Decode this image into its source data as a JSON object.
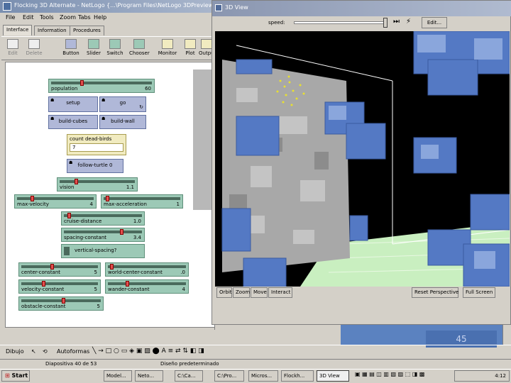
{
  "netlogo": {
    "title": "Flocking 3D Alternate - NetLogo {...\\Program Files\\NetLogo 3DPreview",
    "menus": [
      "File",
      "Edit",
      "Tools",
      "Zoom",
      "Tabs",
      "Help"
    ],
    "tabs": [
      "Interface",
      "Information",
      "Procedures"
    ],
    "toolbar": [
      "Edit",
      "Delete",
      "Button",
      "Slider",
      "Switch",
      "Chooser",
      "Monitor",
      "Plot",
      "Output"
    ],
    "widgets": {
      "population": {
        "label": "population",
        "value": "60"
      },
      "setup": "setup",
      "go": "go",
      "build_cubes": "build-cubes",
      "build_wall": "build-wall",
      "count_monitor": {
        "label": "count dead-birds",
        "value": "7"
      },
      "follow_turtle": "follow-turtle 0",
      "vision": {
        "label": "vision",
        "value": "1.1"
      },
      "max_velocity": {
        "label": "max-velocity",
        "value": "4"
      },
      "max_acceleration": {
        "label": "max-acceleration",
        "value": "1"
      },
      "cruise_distance": {
        "label": "cruise-distance",
        "value": "1.0"
      },
      "spacing_constant": {
        "label": "spacing-constant",
        "value": "3.4"
      },
      "vertical_spacing": {
        "label": "vertical-spacing?",
        "state": "On"
      },
      "center_constant": {
        "label": "center-constant",
        "value": "5"
      },
      "world_center_constant": {
        "label": "world-center-constant",
        "value": ".0"
      },
      "velocity_constant": {
        "label": "velocity-constant",
        "value": "5"
      },
      "wander_constant": {
        "label": "wander-constant",
        "value": "4"
      },
      "obstacle_avoid": {
        "label": "obstacle-constant",
        "value": "5"
      }
    }
  },
  "view3d": {
    "title": "3D View",
    "speed_label": "speed:",
    "edit_button": "Edit...",
    "bottom_buttons": [
      "Orbit",
      "Zoom",
      "Move",
      "Interact"
    ],
    "reset_perspective": "Reset Perspective",
    "full_screen": "Full Screen"
  },
  "powerpoint": {
    "slide_number": "45",
    "status_slide": "Diapositiva 40 de 53",
    "status_design": "Diseño predeterminado",
    "draw_menu": "Dibujo",
    "autoshapes": "Autoformas"
  },
  "taskbar": {
    "start": "Start",
    "tasks": [
      "Model...",
      "Neto...",
      "C:\\Ca...",
      "C:\\Pro...",
      "Micros...",
      "Flockh...",
      "3D View"
    ],
    "active_task": "3D View",
    "tray_time": "4:12"
  },
  "colors": {
    "slider": "#9cc9b6",
    "button": "#b0b8d8",
    "monitor": "#f1ebc0",
    "cube_blue": "#5479c4",
    "wall_gray": "#a8a8a8",
    "floor_green": "#c9efc0"
  }
}
